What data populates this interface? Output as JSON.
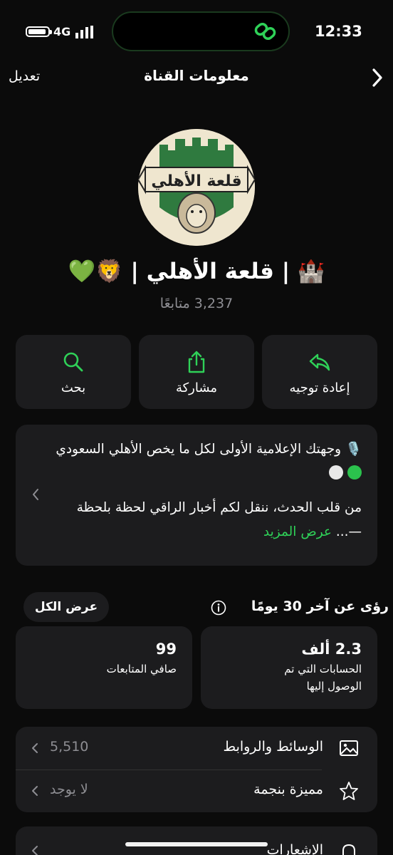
{
  "status": {
    "time": "12:33",
    "network": "4G"
  },
  "header": {
    "title": "معلومات القناة",
    "edit": "تعديل"
  },
  "channel": {
    "name": "🏰 | قلعة  الأهلي | 🦁💚",
    "followers": "3,237 متابعًا",
    "avatar_text": "قلعة الأهلي"
  },
  "actions": [
    {
      "label": "إعادة توجيه",
      "icon": "forward-icon"
    },
    {
      "label": "مشاركة",
      "icon": "share-icon"
    },
    {
      "label": "بحث",
      "icon": "search-icon"
    }
  ],
  "description": {
    "line1": "🎙️ وجهتك الإعلامية الأولى لكل ما يخص الأهلي السعودي",
    "line2": "من قلب الحدث، ننقل لكم أخبار الراقي لحظة بلحظة —...",
    "see_more": "عرض المزيد"
  },
  "insights": {
    "title": "رؤى عن آخر 30 يومًا",
    "see_all": "عرض الكل",
    "stats": [
      {
        "value": "2.3 ألف",
        "caption": "الحسابات التي تم الوصول إليها"
      },
      {
        "value": "99",
        "caption": "صافي المتابعات"
      }
    ]
  },
  "list": [
    {
      "label": "الوسائط والروابط",
      "value": "5,510",
      "icon": "photo-icon"
    },
    {
      "label": "مميزة بنجمة",
      "value": "لا يوجد",
      "icon": "star-icon"
    },
    {
      "label": "الإشعارات",
      "icon": "bell-icon"
    }
  ],
  "colors": {
    "accent": "#2fd158",
    "card": "#1c1c1e",
    "background": "#0b0b0b"
  }
}
